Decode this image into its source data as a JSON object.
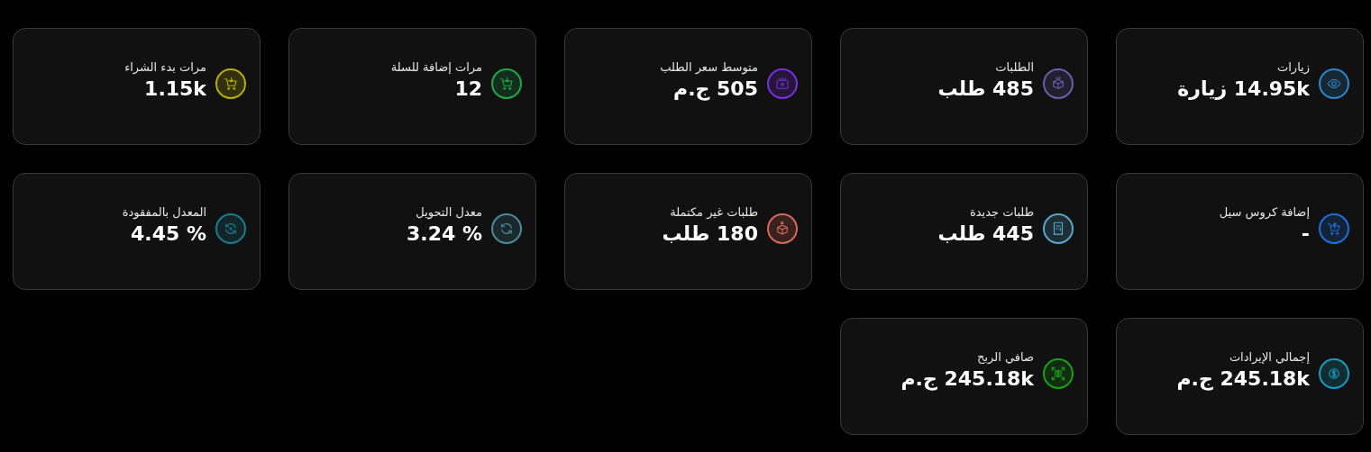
{
  "cards": [
    {
      "title": "زيارات",
      "value": "14.95k زيارة",
      "kind": "eye",
      "color": "#2f86c8"
    },
    {
      "title": "الطلبات",
      "value": "485 طلب",
      "kind": "box",
      "color": "#6a5fa8"
    },
    {
      "title": "متوسط سعر الطلب",
      "value": "505 ج.م",
      "kind": "wallet",
      "color": "#7a2fe0"
    },
    {
      "title": "مرات إضافة للسلة",
      "value": "12",
      "kind": "cartdown",
      "color": "#1fa84a"
    },
    {
      "title": "مرات بدء الشراء",
      "value": "1.15k",
      "kind": "cartdown",
      "color": "#b8b000"
    },
    {
      "title": "إضافة كروس سيل",
      "value": "-",
      "kind": "cartup",
      "color": "#1f6fd8"
    },
    {
      "title": "طلبات جديدة",
      "value": "445 طلب",
      "kind": "receipt",
      "color": "#5aa6c8"
    },
    {
      "title": "طلبات غير مكتملة",
      "value": "180 طلب",
      "kind": "boxx",
      "color": "#d8695a"
    },
    {
      "title": "معدل التحويل",
      "value": "% 3.24",
      "kind": "refresh",
      "color": "#4a8a9a"
    },
    {
      "title": "المعدل بالمفقودة",
      "value": "% 4.45",
      "kind": "refreshx",
      "color": "#1a7c8c"
    },
    {
      "title": "إجمالي الإيرادات",
      "value": "245.18k ج.م",
      "kind": "dollar",
      "color": "#1a9cc0"
    },
    {
      "title": "صافي الربح",
      "value": "245.18k ج.م",
      "kind": "dollararrows",
      "color": "#18a018"
    }
  ]
}
